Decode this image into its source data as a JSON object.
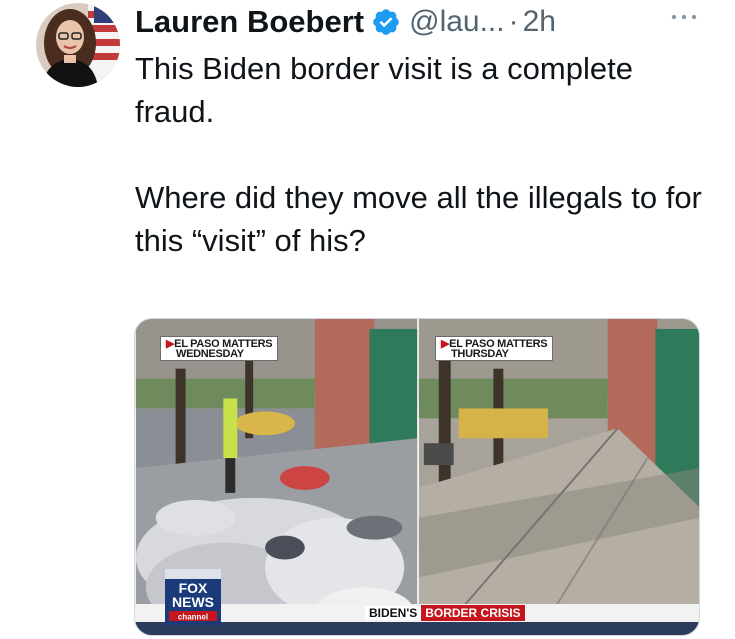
{
  "tweet": {
    "author_name": "Lauren Boebert",
    "handle": "@lau...",
    "separator": "·",
    "time": "2h",
    "paragraphs": [
      "This Biden border visit is a complete fraud.",
      "Where did they move all the illegals to for this “visit” of his?"
    ]
  },
  "media": {
    "left_label_line1": "EL PASO MATTERS",
    "left_label_line2": "WEDNESDAY",
    "right_label_line1": "EL PASO MATTERS",
    "right_label_line2": "THURSDAY",
    "logo_line1": "FOX",
    "logo_line2": "NEWS",
    "logo_line3": "channel",
    "banner_part1": "BIDEN'S",
    "banner_part2": "BORDER CRISIS"
  },
  "icons": {
    "verified": "verified-badge-icon",
    "more": "more-dots-icon"
  },
  "colors": {
    "verified_blue": "#1d9bf0",
    "secondary_text": "#536471",
    "fox_red": "#c4161c"
  }
}
